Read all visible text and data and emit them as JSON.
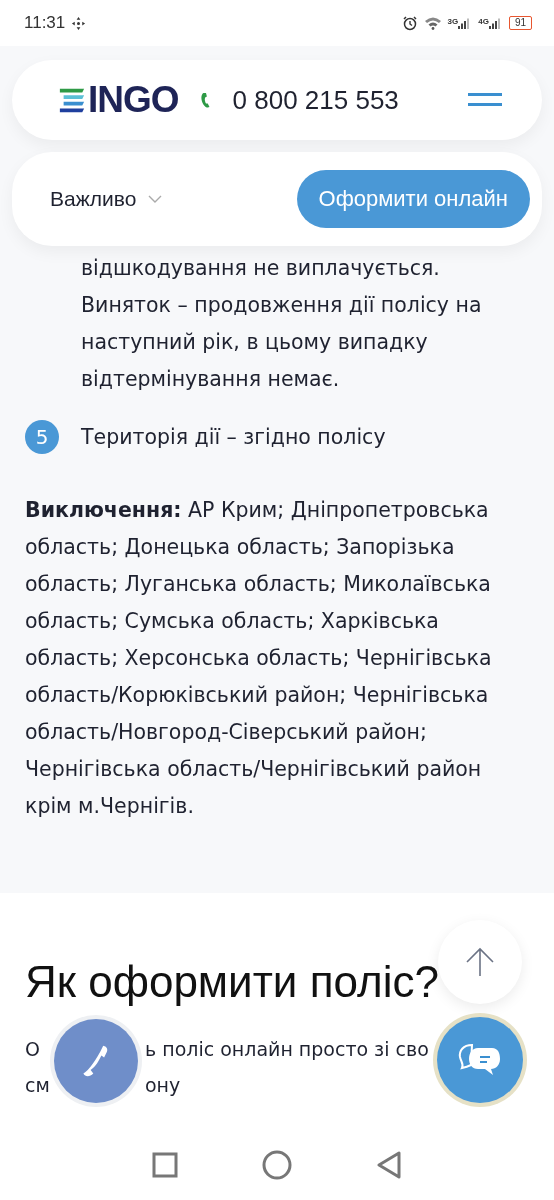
{
  "status_bar": {
    "time": "11:31",
    "network_labels": [
      "3G",
      "4G"
    ],
    "battery": "91"
  },
  "header": {
    "logo": "INGO",
    "phone": "0 800 215 553"
  },
  "subnav": {
    "section": "Важливо",
    "expanded": false,
    "cta": "Оформити онлайн"
  },
  "content": {
    "continued_text": "відшкодування не виплачується. Виняток – продовження дії полісу на наступний рік, в цьому випадку відтермінування немає.",
    "items": [
      {
        "number": "5",
        "text": "Територія дії – згідно полісу"
      }
    ],
    "exclusions": "**Виключення:** АР Крим; Дніпропетровська область; Донецька область; Запорізька область; Луганська область; Миколаївська область; Сумська область; Харківська область; Херсонська область; Чернігівська область/Корюківський район; Чернігівська область/Новгород-Сіверський район; Чернігівська область/Чернігівський район крім м.Чернігів."
  },
  "how_to": {
    "title": "Як оформити поліс?",
    "text_lines": [
      [
        "О",
        "ь поліс онлайн просто зі сво"
      ],
      [
        "см",
        "ону"
      ]
    ]
  }
}
